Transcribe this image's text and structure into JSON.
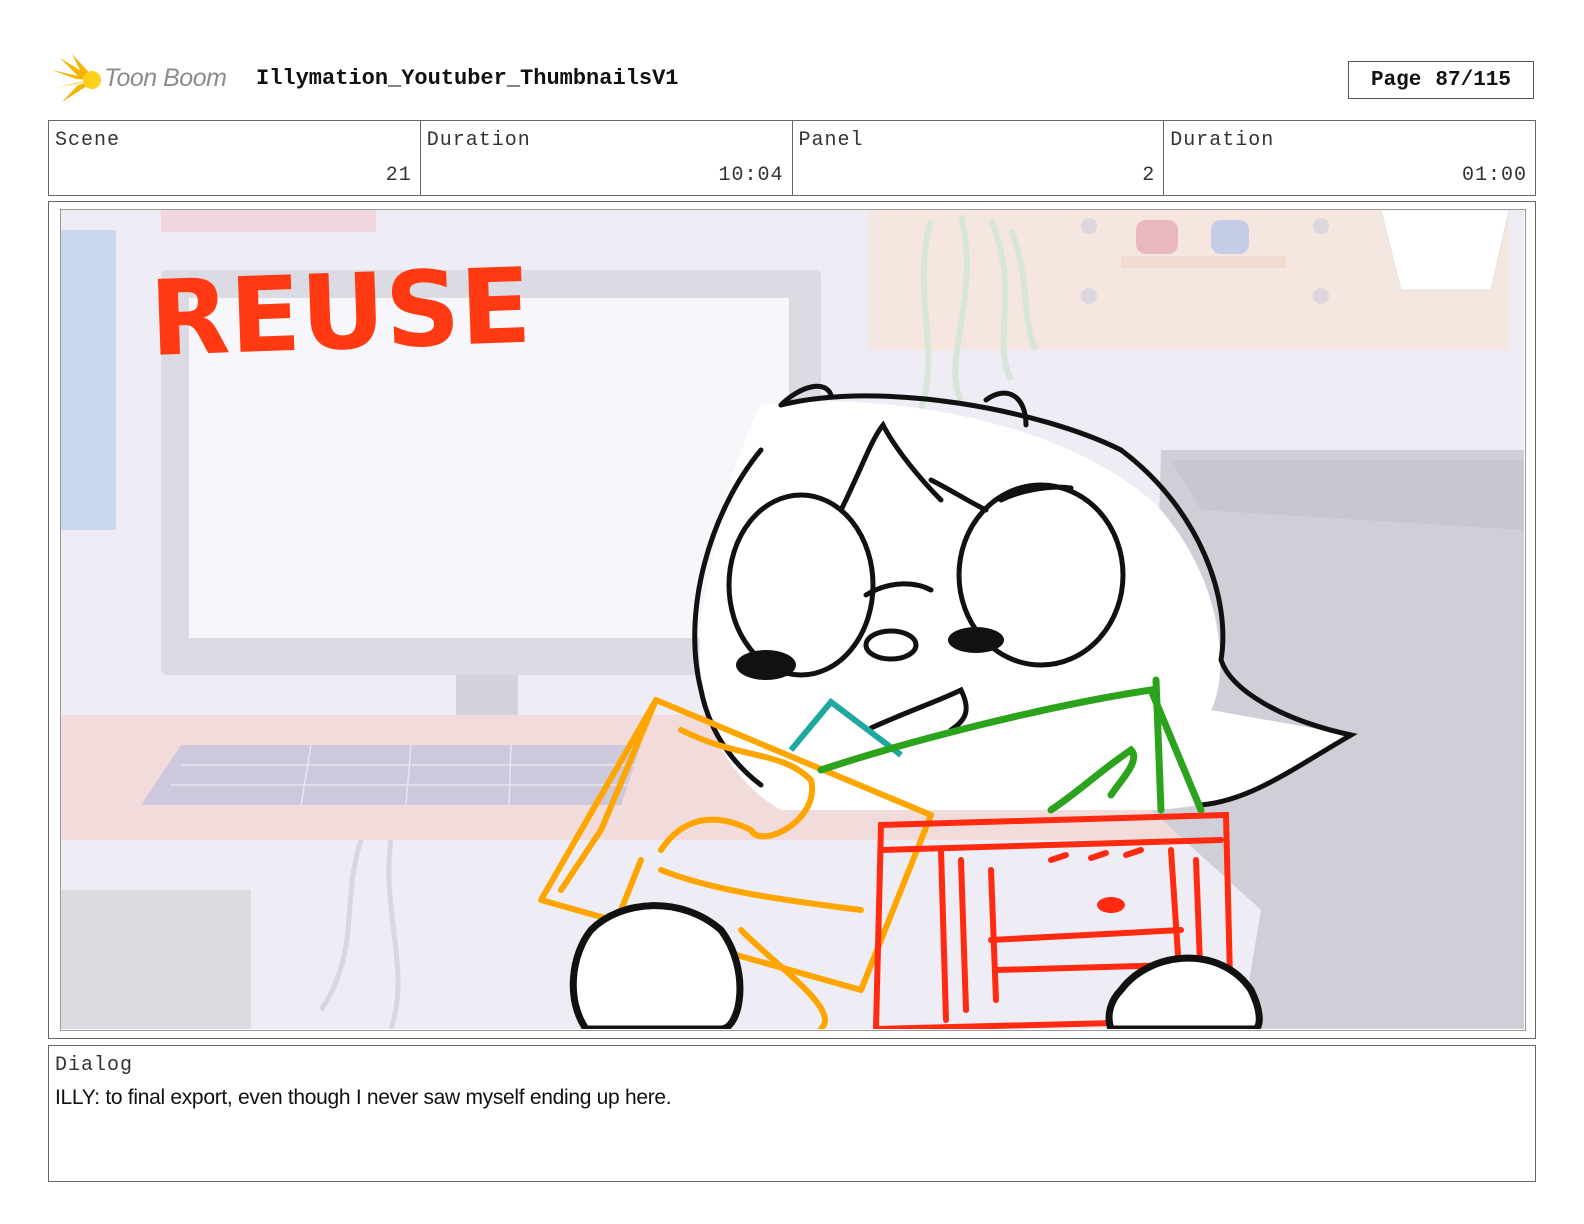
{
  "header": {
    "logo_text": "Toon Boom",
    "logo_icon": "starburst-logo-icon",
    "title": "Illymation_Youtuber_ThumbnailsV1",
    "page_label": "Page",
    "page_value": "87/115"
  },
  "info": {
    "scene_label": "Scene",
    "scene_value": "21",
    "duration_label": "Duration",
    "duration_value": "10:04",
    "panel_label": "Panel",
    "panel_value": "2",
    "panel_duration_label": "Duration",
    "panel_duration_value": "01:00"
  },
  "panel": {
    "overlay_text": "REUSE",
    "overlay_color": "#ff3a12"
  },
  "dialog": {
    "label": "Dialog",
    "text": "ILLY: to final export, even though I never saw myself ending up here."
  }
}
